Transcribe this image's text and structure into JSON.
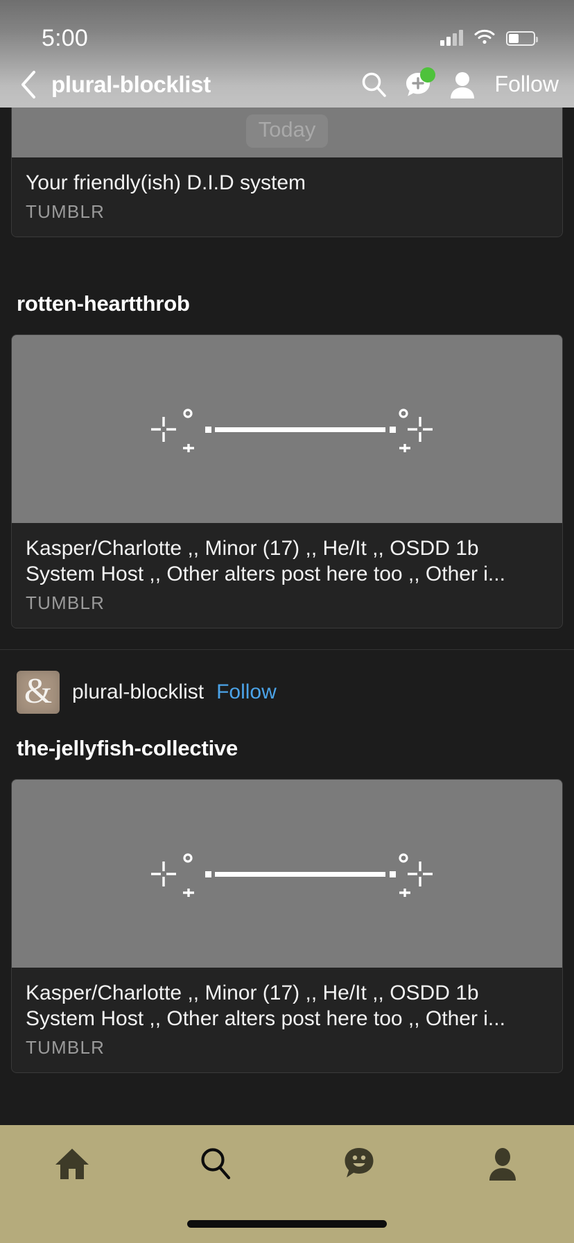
{
  "status_bar": {
    "time": "5:00",
    "cellular_icon": "cellular-bars-icon",
    "wifi_icon": "wifi-icon",
    "battery_icon": "battery-icon",
    "battery_level_pct": 40
  },
  "nav_bar": {
    "back_icon": "chevron-left-icon",
    "title": "plural-blocklist",
    "search_icon": "search-icon",
    "messages_icon": "chat-plus-icon",
    "messages_badge": "unread-dot",
    "account_icon": "person-icon",
    "follow_label": "Follow",
    "follow_color": "#ffffff"
  },
  "feed": {
    "date_chip": "Today",
    "posts": [
      {
        "id": "post-clipped-top",
        "card_title": "Your friendly(ish) D.I.D system",
        "card_source": "TUMBLR",
        "media_icon": "broken-image-placeholder-icon"
      },
      {
        "id": "post-rotten-heartthrob",
        "blog_name": "rotten-heartthrob",
        "card_title": "Kasper/Charlotte ,, Minor (17) ,, He/It ,, OSDD 1b System Host ,, Other alters post here too ,, Other i...",
        "card_source": "TUMBLR",
        "media_icon": "broken-image-placeholder-icon"
      },
      {
        "id": "post-the-jellyfish-collective",
        "attribution": {
          "avatar_glyph": "&",
          "avatar_name": "avatar",
          "blog_handle": "plural-blocklist",
          "follow_label": "Follow",
          "follow_color": "#4ba3e8"
        },
        "blog_name": "the-jellyfish-collective",
        "card_title": "Kasper/Charlotte ,, Minor (17) ,, He/It ,, OSDD 1b System Host ,, Other alters post here too ,, Other i...",
        "card_source": "TUMBLR",
        "media_icon": "broken-image-placeholder-icon"
      }
    ]
  },
  "tab_bar": {
    "background_color": "#b5ab7c",
    "tabs": [
      {
        "id": "tab-home",
        "icon": "home-icon",
        "selected": true
      },
      {
        "id": "tab-search",
        "icon": "search-icon",
        "selected": false
      },
      {
        "id": "tab-messages",
        "icon": "chat-smiley-icon",
        "selected": false
      },
      {
        "id": "tab-account",
        "icon": "person-icon",
        "selected": false
      }
    ],
    "home_indicator": "home-indicator"
  },
  "theme": {
    "page_bg": "#1c1c1c",
    "card_bg": "#232323",
    "card_border": "#3a3a3a",
    "media_placeholder_bg": "#7b7b7b",
    "text_primary": "#f2f2f2",
    "text_secondary": "#9a9a9a",
    "accent_link": "#4ba3e8",
    "badge_green": "#4ec23b"
  }
}
